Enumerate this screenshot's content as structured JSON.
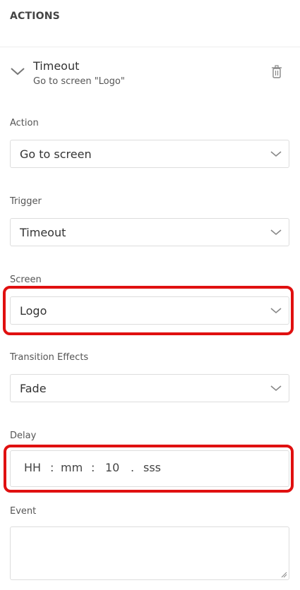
{
  "section": {
    "title": "ACTIONS"
  },
  "action": {
    "name": "Timeout",
    "summary": "Go to screen \"Logo\""
  },
  "fields": {
    "action": {
      "label": "Action",
      "value": "Go to screen"
    },
    "trigger": {
      "label": "Trigger",
      "value": "Timeout"
    },
    "screen": {
      "label": "Screen",
      "value": "Logo"
    },
    "transition": {
      "label": "Transition Effects",
      "value": "Fade"
    },
    "delay": {
      "label": "Delay",
      "hours": "HH",
      "minutes": "mm",
      "seconds": "10",
      "milliseconds": "sss",
      "sep_colon": ":",
      "sep_dot": "."
    },
    "event": {
      "label": "Event",
      "value": ""
    }
  },
  "icons": {
    "collapse": "chevron-down-icon",
    "delete": "trash-icon",
    "dropdown": "chevron-down-icon",
    "resize": "resize-grip-icon"
  },
  "colors": {
    "highlight": "#e01010",
    "border": "#dddddd"
  }
}
